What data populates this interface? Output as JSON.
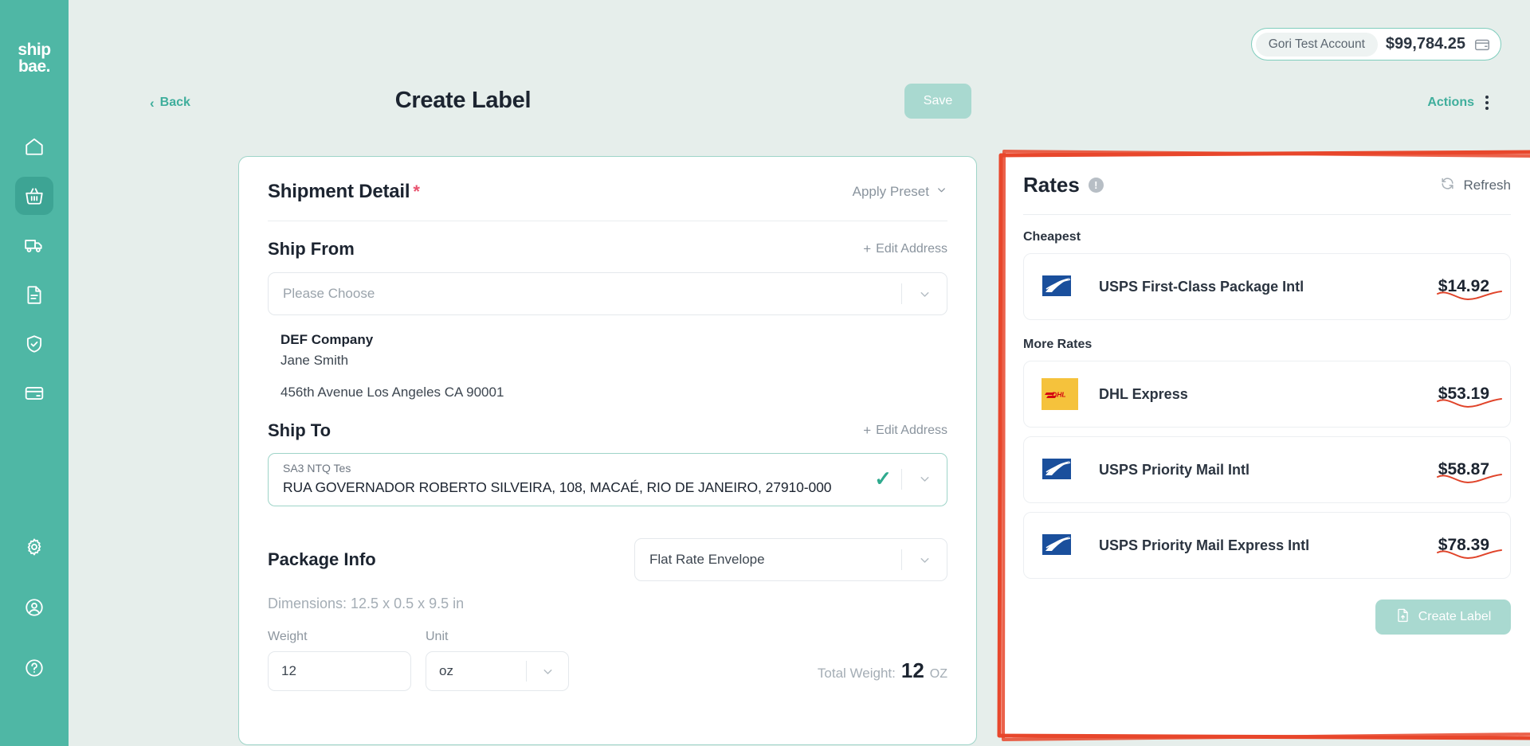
{
  "brand": {
    "logo_line1": "ship",
    "logo_line2": "bae",
    "logo_dot": ".",
    "accent": "#4fb7a5",
    "accent_dark": "#3da494"
  },
  "sidebar": {
    "top_items": [
      {
        "icon": "home-icon",
        "name": "home",
        "active": false
      },
      {
        "icon": "basket-icon",
        "name": "orders",
        "active": true
      },
      {
        "icon": "truck-icon",
        "name": "shipments",
        "active": false
      },
      {
        "icon": "document-icon",
        "name": "documents",
        "active": false
      },
      {
        "icon": "shield-check-icon",
        "name": "insurance",
        "active": false
      },
      {
        "icon": "credit-card-icon",
        "name": "billing",
        "active": false
      }
    ],
    "bottom_items": [
      {
        "icon": "gear-icon",
        "name": "settings"
      },
      {
        "icon": "user-circle-icon",
        "name": "account"
      },
      {
        "icon": "help-circle-icon",
        "name": "help"
      }
    ]
  },
  "header": {
    "account_name": "Gori Test Account",
    "account_balance": "$99,784.25",
    "wallet_icon": "wallet-icon"
  },
  "page": {
    "back_label": "Back",
    "title": "Create Label",
    "save_label": "Save",
    "actions_label": "Actions",
    "kebab_icon": "vertical-dots-icon"
  },
  "shipment_detail": {
    "title": "Shipment Detail",
    "required_mark": "*",
    "apply_preset_label": "Apply Preset",
    "chevron_icon": "chevron-down-icon",
    "ship_from": {
      "heading": "Ship From",
      "edit_label": "Edit Address",
      "plus_icon": "plus-icon",
      "select_placeholder": "Please Choose",
      "company": "DEF Company",
      "contact": "Jane Smith",
      "address": "456th Avenue Los Angeles CA 90001"
    },
    "ship_to": {
      "heading": "Ship To",
      "edit_label": "Edit Address",
      "plus_icon": "plus-icon",
      "name": "SA3 NTQ Tes",
      "address": "RUA GOVERNADOR ROBERTO SILVEIRA, 108, MACAÉ, RIO DE JANEIRO, 27910-000",
      "valid_icon": "check-icon"
    },
    "package_info": {
      "heading": "Package Info",
      "package_type": "Flat Rate Envelope",
      "dimensions": "Dimensions: 12.5 x 0.5 x 9.5 in",
      "weight_label": "Weight",
      "weight_value": "12",
      "unit_label": "Unit",
      "unit_value": "oz",
      "total_weight_label": "Total Weight:",
      "total_weight_value": "12",
      "total_weight_unit": "OZ"
    }
  },
  "rates": {
    "title": "Rates",
    "info_icon": "info-icon",
    "info_glyph": "!",
    "refresh_label": "Refresh",
    "refresh_icon": "refresh-icon",
    "cheapest_label": "Cheapest",
    "more_rates_label": "More Rates",
    "cheapest": [
      {
        "carrier": "usps",
        "name": "USPS First-Class Package Intl",
        "price": "$14.92"
      }
    ],
    "more": [
      {
        "carrier": "dhl",
        "name": "DHL Express",
        "price": "$53.19"
      },
      {
        "carrier": "usps",
        "name": "USPS Priority Mail Intl",
        "price": "$58.87"
      },
      {
        "carrier": "usps",
        "name": "USPS Priority Mail Express Intl",
        "price": "$78.39"
      }
    ],
    "create_label_button": "Create Label",
    "create_label_icon": "document-upload-icon"
  },
  "annotation": {
    "color": "#e8472c",
    "target": "rates-panel"
  }
}
